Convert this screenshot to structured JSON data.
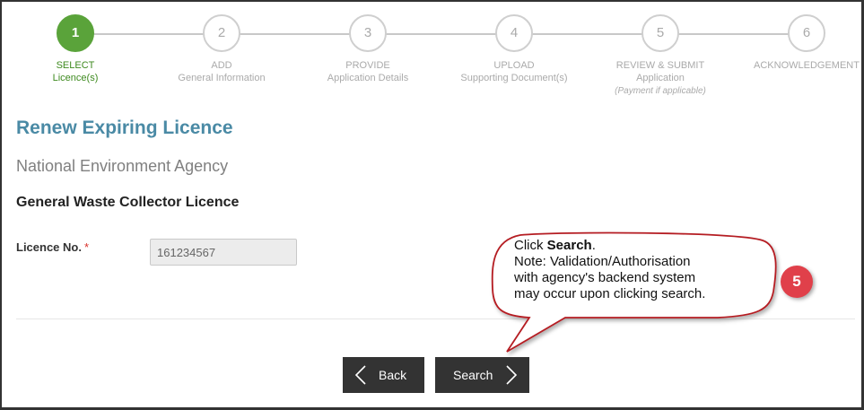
{
  "stepper": {
    "steps": [
      {
        "number": "1",
        "title": "SELECT",
        "subtitle": "Licence(s)",
        "note": ""
      },
      {
        "number": "2",
        "title": "ADD",
        "subtitle": "General Information",
        "note": ""
      },
      {
        "number": "3",
        "title": "PROVIDE",
        "subtitle": "Application Details",
        "note": ""
      },
      {
        "number": "4",
        "title": "UPLOAD",
        "subtitle": "Supporting Document(s)",
        "note": ""
      },
      {
        "number": "5",
        "title": "REVIEW & SUBMIT",
        "subtitle": "Application",
        "note": "(Payment if applicable)"
      },
      {
        "number": "6",
        "title": "ACKNOWLEDGEMENT",
        "subtitle": "",
        "note": ""
      }
    ],
    "active_step": 1,
    "active_color": "#5aa33a"
  },
  "page": {
    "title": "Renew Expiring Licence",
    "agency": "National Environment Agency",
    "licence_name": "General Waste Collector Licence"
  },
  "form": {
    "licence_no_label": "Licence No.",
    "required_mark": "*",
    "licence_no_value": "161234567"
  },
  "buttons": {
    "back_label": "Back",
    "search_label": "Search"
  },
  "callout": {
    "line1_prefix": "Click ",
    "line1_bold": "Search",
    "line1_suffix": ".",
    "line2": "Note: Validation/Authorisation",
    "line3": "with agency's backend system",
    "line4": "may occur upon clicking search."
  },
  "badge": {
    "number": "5",
    "color": "#e0404a"
  }
}
